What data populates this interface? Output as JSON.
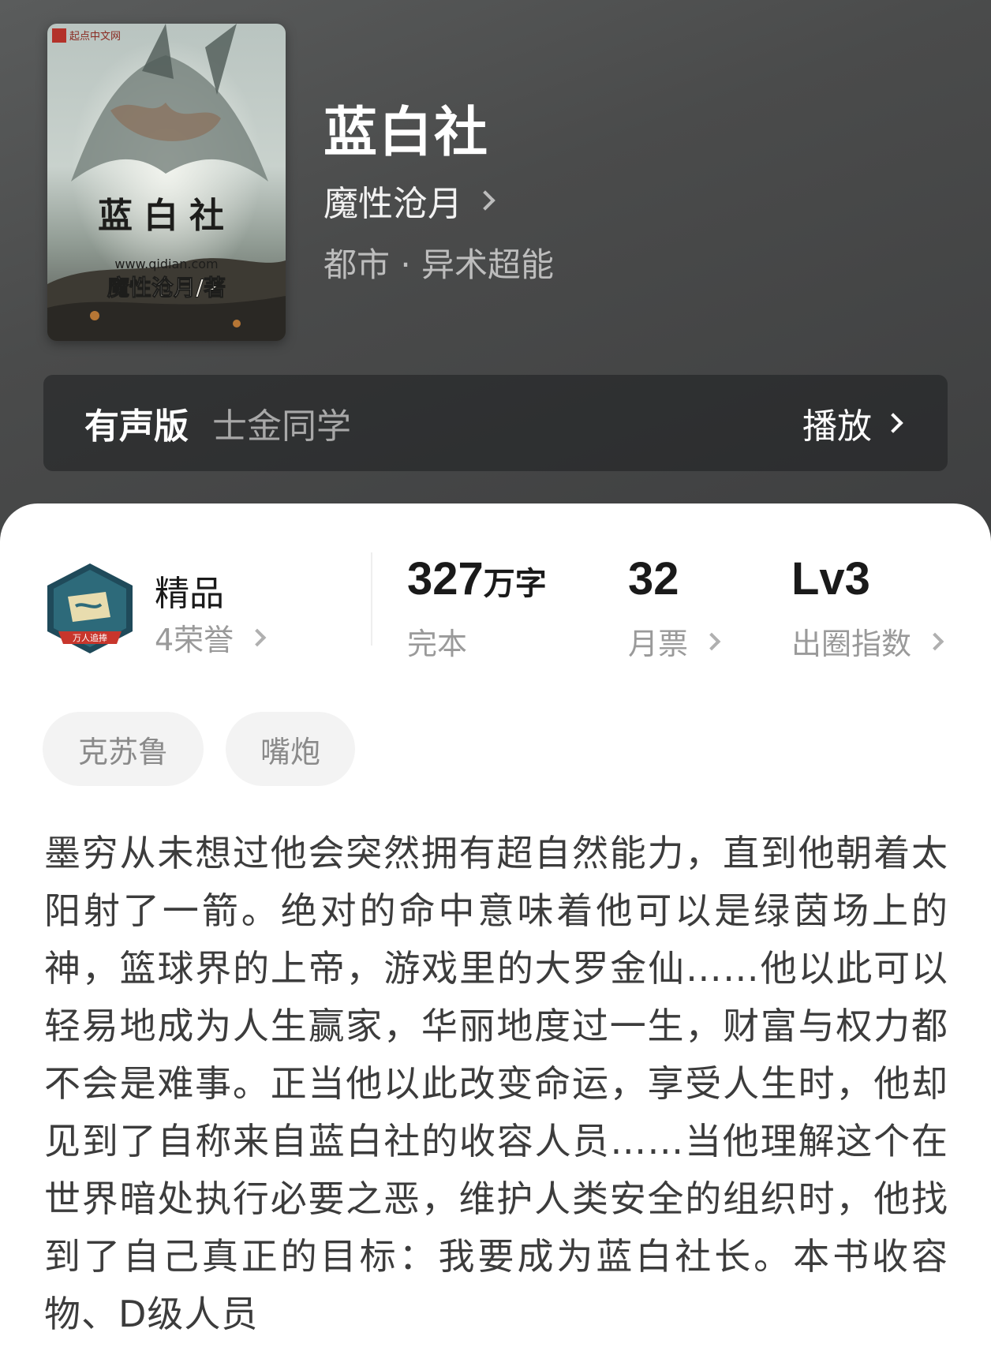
{
  "book": {
    "title": "蓝白社",
    "author": "魔性沧月",
    "genre": "都市 · 异术超能",
    "cover": {
      "publisher_mark": "起点中文网",
      "title_text": "蓝白社",
      "site_text": "www.qidian.com",
      "author_text": "魔性沧月/著"
    }
  },
  "audio": {
    "label": "有声版",
    "narrator": "士金同学",
    "play_label": "播放"
  },
  "quality": {
    "title": "精品",
    "honors": "4荣誉",
    "badge_text": "万人追捧"
  },
  "stats": {
    "words_value": "327",
    "words_unit": "万字",
    "words_label": "完本",
    "votes_value": "32",
    "votes_label": "月票",
    "level_value": "Lv3",
    "level_label": "出圈指数"
  },
  "tags": [
    "克苏鲁",
    "嘴炮"
  ],
  "synopsis": "墨穷从未想过他会突然拥有超自然能力，直到他朝着太阳射了一箭。绝对的命中意味着他可以是绿茵场上的神，篮球界的上帝，游戏里的大罗金仙……他以此可以轻易地成为人生赢家，华丽地度过一生，财富与权力都不会是难事。正当他以此改变命运，享受人生时，他却见到了自称来自蓝白社的收容人员……当他理解这个在世界暗处执行必要之恶，维护人类安全的组织时，他找到了自己真正的目标：我要成为蓝白社长。本书收容物、D级人员"
}
